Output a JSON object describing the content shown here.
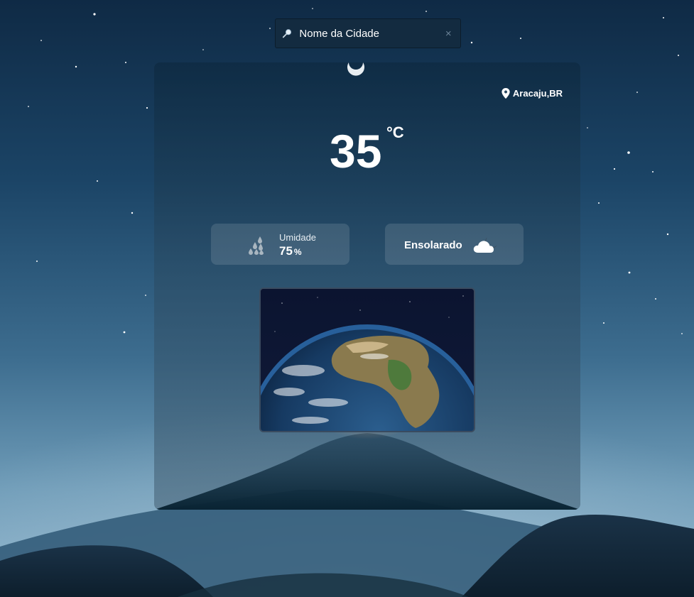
{
  "search": {
    "placeholder": "Nome da Cidade",
    "clear_symbol": "×"
  },
  "weather": {
    "location": "Aracaju,BR",
    "temperature": "35",
    "temperature_unit": "°C",
    "humidity_label": "Umidade",
    "humidity_value": "75",
    "humidity_unit": "%",
    "condition": "Ensolarado"
  },
  "icons": {
    "search": "search-icon",
    "clear": "close-icon",
    "location": "map-pin-icon",
    "humidity": "raindrops-icon",
    "condition": "cloud-moon-icon"
  },
  "colors": {
    "text": "#ffffff",
    "search_bg": "#132b40",
    "tile_bg": "rgba(255,255,255,0.12)"
  }
}
